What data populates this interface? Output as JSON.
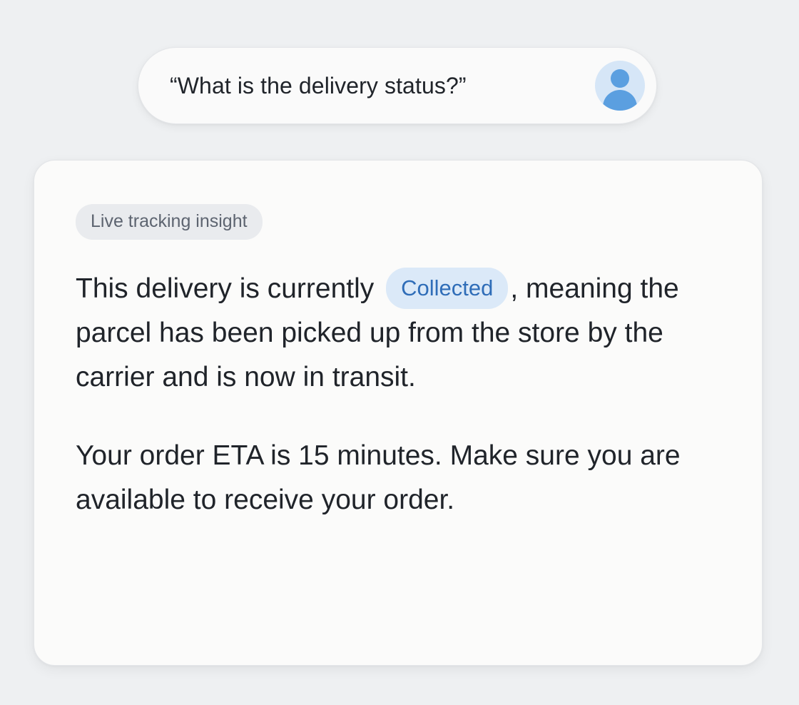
{
  "query": {
    "text": "“What is the delivery status?”",
    "avatar_icon": "user-avatar-icon"
  },
  "insight": {
    "tag": "Live tracking insight",
    "status_pre": "This delivery is currently ",
    "status_value": "Collected",
    "status_post": ", meaning the parcel has been picked up from the store by the carrier and is now in transit.",
    "eta_message": "Your order ETA is 15 minutes. Make sure you are available to receive your order."
  },
  "colors": {
    "page_background": "#eef0f2",
    "card_background": "#fbfbfa",
    "status_chip_background": "#dbe9f8",
    "status_chip_text": "#2f6db8",
    "avatar_accent": "#5b9fe0"
  }
}
